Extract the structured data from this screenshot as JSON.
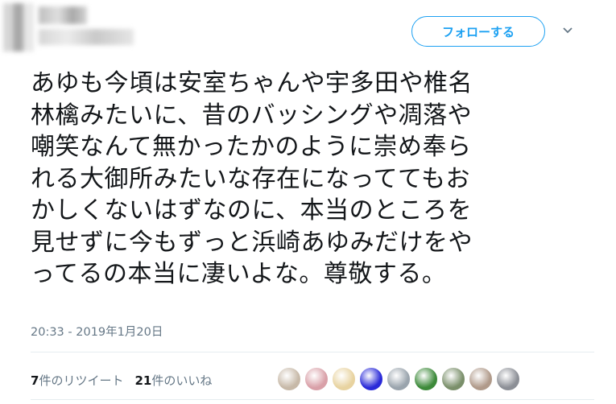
{
  "header": {
    "follow_label": "フォローする"
  },
  "tweet": {
    "lines": [
      "あゆも今頃は安室ちゃんや宇多田や椎名",
      "林檎みたいに、昔のバッシングや凋落や",
      "嘲笑なんて無かったかのように崇め奉ら",
      "れる大御所みたいな存在になっててもお",
      "かしくないはずなのに、本当のところを",
      "見せずに今もずっと浜崎あゆみだけをや",
      "ってるの本当に凄いよな。尊敬する。"
    ],
    "timestamp": "20:33 - 2019年1月20日"
  },
  "stats": {
    "retweet_count": "7",
    "retweet_label": "件のリツイート",
    "like_count": "21",
    "like_label": "件のいいね"
  },
  "likers": [
    {
      "icon": "avatar-1",
      "color": "#c7b9a8"
    },
    {
      "icon": "avatar-2",
      "color": "#d9a0a8"
    },
    {
      "icon": "avatar-3",
      "color": "#e8d3a0"
    },
    {
      "icon": "avatar-4",
      "color": "#2a2ad8"
    },
    {
      "icon": "avatar-5",
      "color": "#9aa4ad"
    },
    {
      "icon": "avatar-6",
      "color": "#3d8a3a"
    },
    {
      "icon": "avatar-7",
      "color": "#7a8f6a"
    },
    {
      "icon": "avatar-8",
      "color": "#b09a8a"
    },
    {
      "icon": "avatar-9",
      "color": "#8c8f96"
    }
  ],
  "colors": {
    "accent": "#1da1f2",
    "text": "#14171a",
    "secondary": "#657786"
  }
}
